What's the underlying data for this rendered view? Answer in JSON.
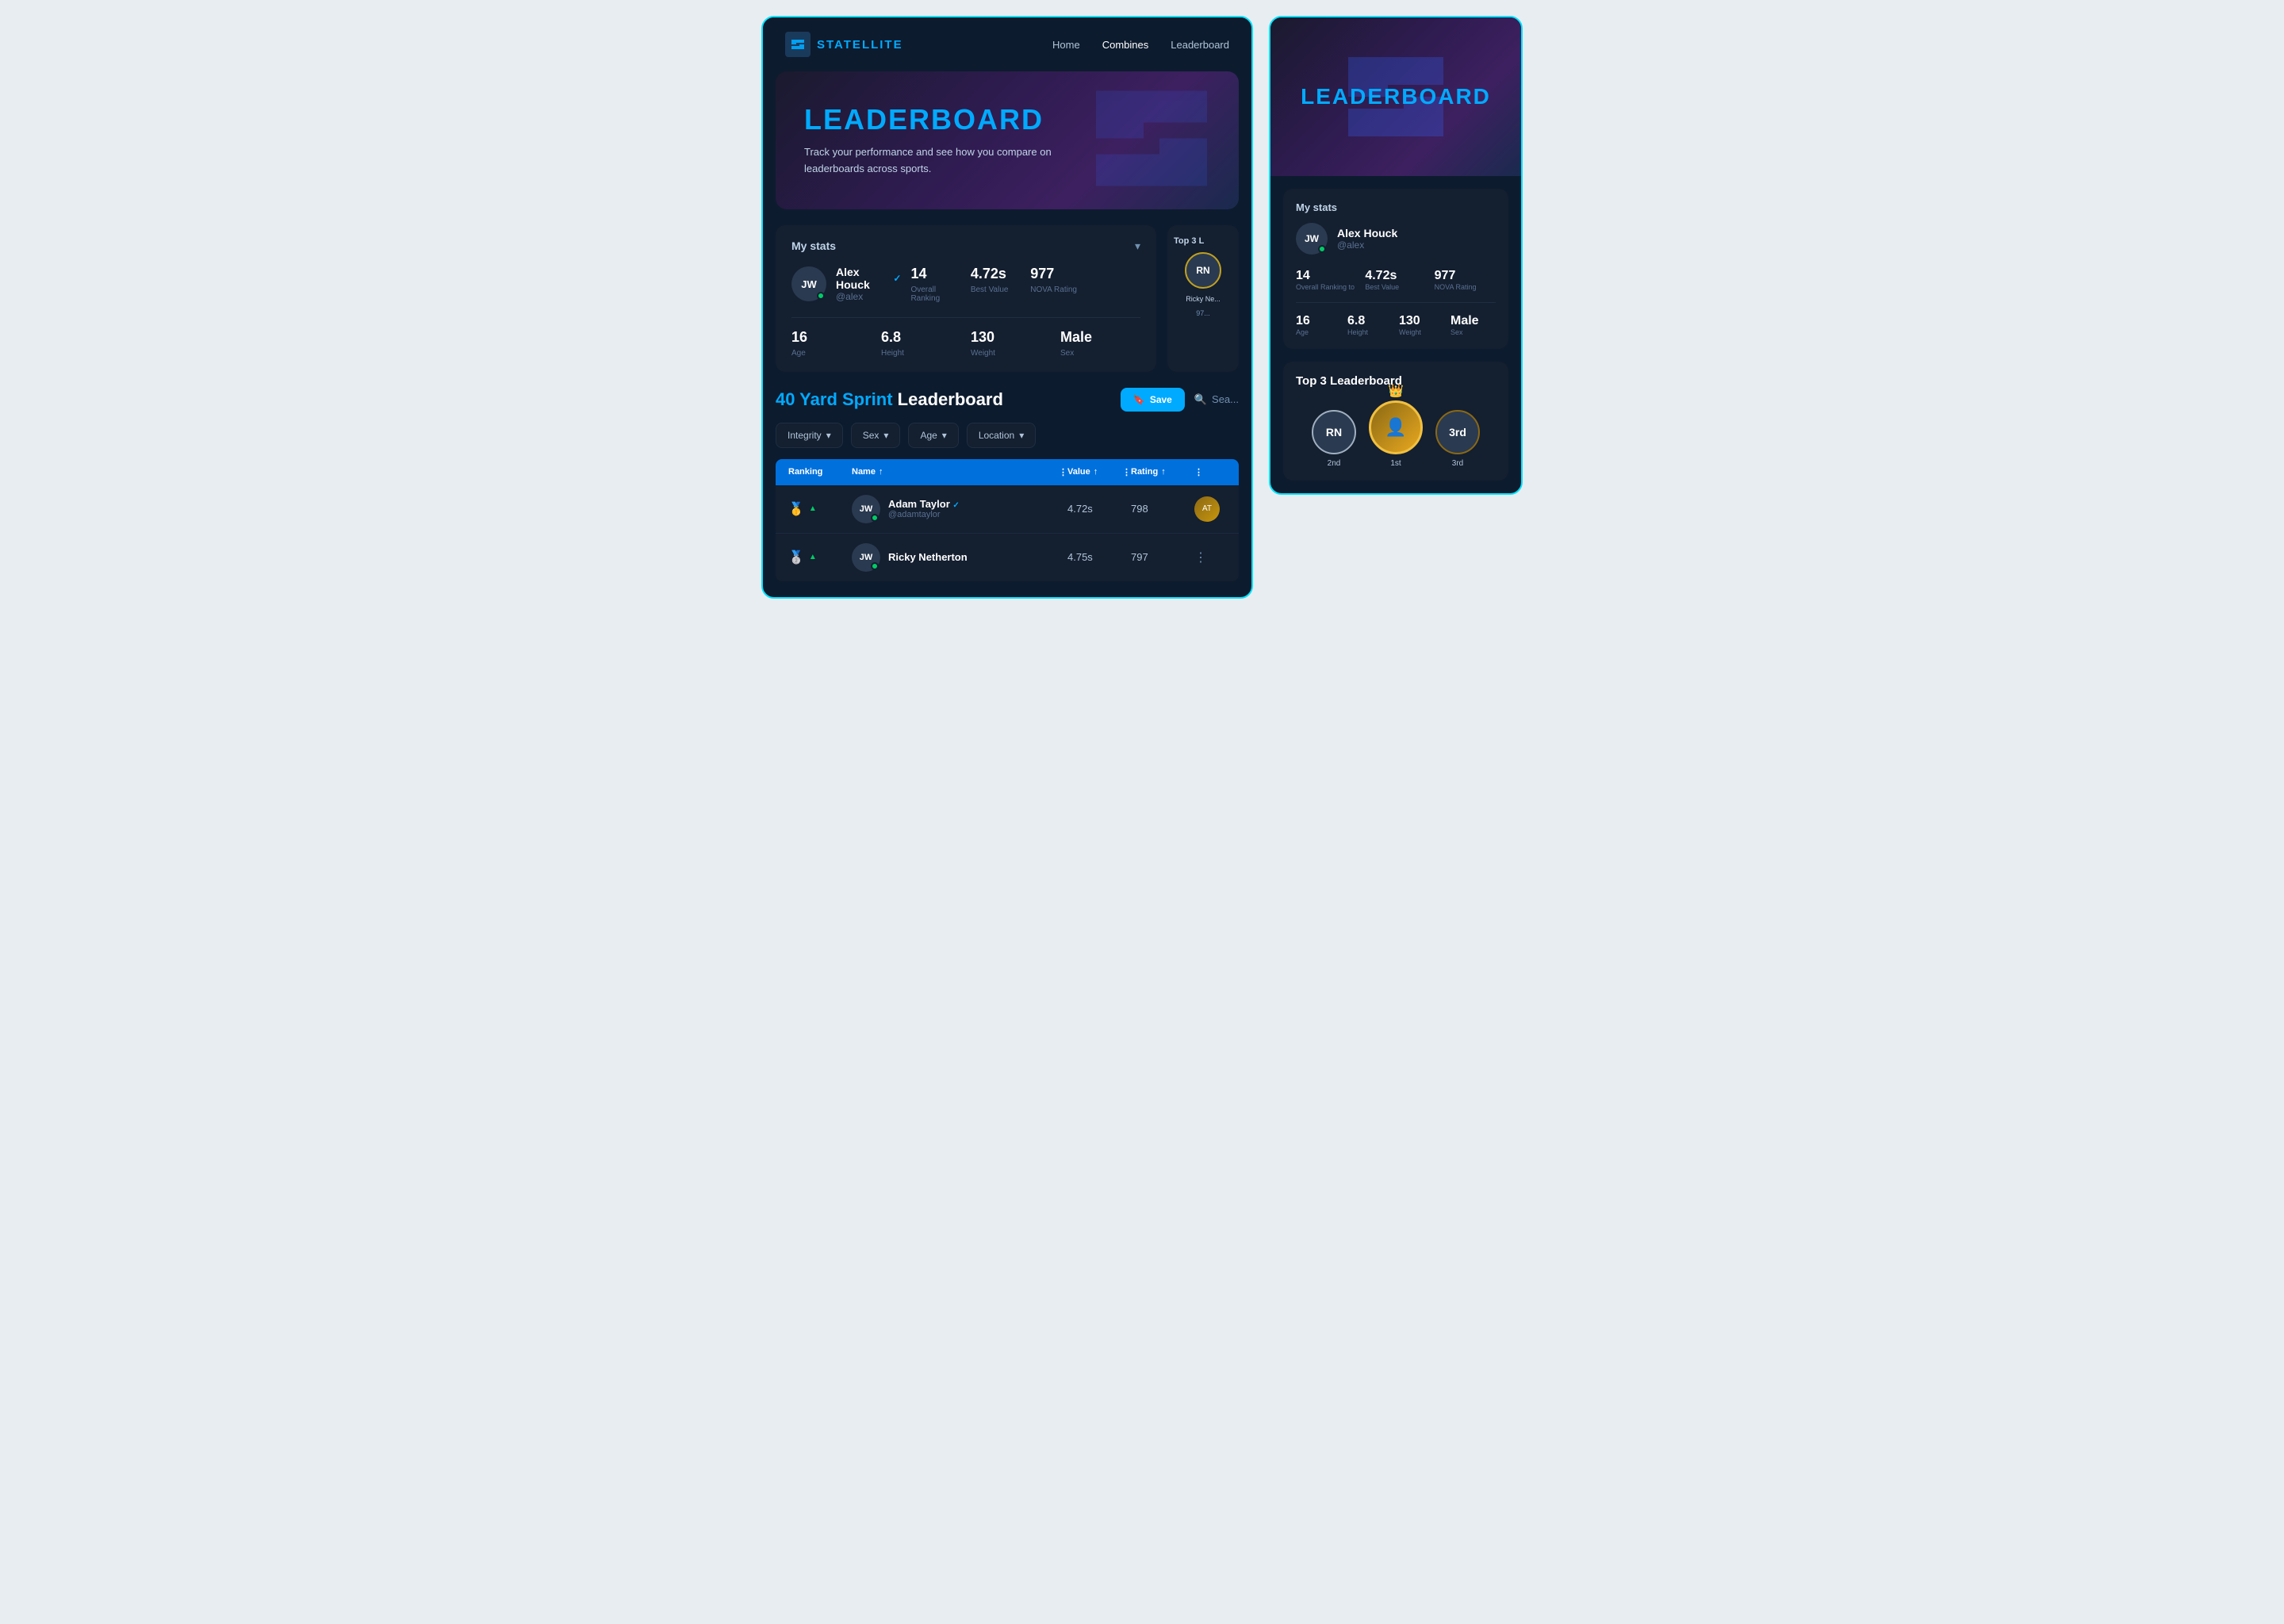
{
  "app": {
    "name": "STATELLITE",
    "nav": {
      "links": [
        "Home",
        "Combines",
        "Leaderboard"
      ]
    }
  },
  "hero": {
    "title": "LEADERBOARD",
    "subtitle": "Track your performance and see how you compare on leaderboards across sports."
  },
  "myStats": {
    "title": "My stats",
    "user": {
      "initials": "JW",
      "name": "Alex Houck",
      "handle": "@alex",
      "verified": true
    },
    "stats": [
      {
        "value": "14",
        "label": "Overall Ranking"
      },
      {
        "value": "4.72s",
        "label": "Best Value"
      },
      {
        "value": "977",
        "label": "NOVA Rating"
      }
    ],
    "stats2": [
      {
        "value": "16",
        "label": "Age"
      },
      {
        "value": "6.8",
        "label": "Height"
      },
      {
        "value": "130",
        "label": "Weight"
      },
      {
        "value": "Male",
        "label": "Sex"
      }
    ]
  },
  "leaderboard": {
    "sport": "40 Yard Sprint",
    "type": "Leaderboard",
    "saveLabel": "Save",
    "searchLabel": "Sea...",
    "filters": [
      "Integrity",
      "Sex",
      "Age",
      "Location"
    ],
    "columns": [
      "Ranking",
      "Name",
      "Value",
      "Rating"
    ],
    "rows": [
      {
        "rank": "🥇",
        "trend": "▲",
        "initials": "JW",
        "name": "Adam Taylor",
        "handle": "@adamtaylor",
        "verified": true,
        "value": "4.72s",
        "rating": "798"
      },
      {
        "rank": "🥈",
        "trend": "▲",
        "initials": "JW",
        "name": "Ricky Netherton",
        "handle": "",
        "verified": false,
        "value": "4.75s",
        "rating": "797"
      }
    ]
  },
  "top3": {
    "title": "Top 3 L",
    "sideTitle": "Top 3 Leaderboard",
    "items": [
      {
        "initials": "RN",
        "name": "Ricky Ne...",
        "score": "97..."
      },
      {
        "initials": "👤",
        "name": "1st",
        "photo": true
      },
      {
        "initials": "3rd",
        "name": "3rd"
      }
    ]
  },
  "sideWindow": {
    "myStats": {
      "title": "My stats",
      "user": {
        "initials": "JW",
        "name": "Alex Houck",
        "handle": "@alex"
      },
      "stats": [
        {
          "value": "14",
          "label": "Overall Ranking to"
        },
        {
          "value": "4.72s",
          "label": "Best Value"
        },
        {
          "value": "977",
          "label": "NOVA Rating"
        }
      ],
      "stats2": [
        {
          "value": "16",
          "label": "Age"
        },
        {
          "value": "6.8",
          "label": "Height"
        },
        {
          "value": "130",
          "label": "Weight"
        },
        {
          "value": "Male",
          "label": "Sex"
        }
      ]
    }
  }
}
